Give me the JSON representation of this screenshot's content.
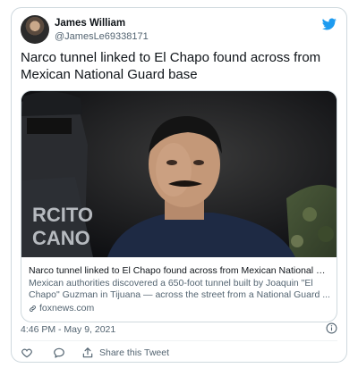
{
  "tweet": {
    "author_name": "James William",
    "author_handle": "@JamesLe69338171",
    "text": "Narco tunnel linked to El Chapo found across from Mexican National Guard base",
    "timestamp": "4:46 PM - May 9, 2021",
    "brand_color": "#1d9bf0"
  },
  "link_card": {
    "image_overlay_text": "RCITO\nCANO",
    "title": "Narco tunnel linked to El Chapo found across from Mexican National Gu...",
    "description": "Mexican authorities discovered a 650-foot tunnel built by Joaquin \"El Chapo\" Guzman in Tijuana — across the street from a National Guard ...",
    "domain": "foxnews.com"
  },
  "actions": {
    "share_label": "Share this Tweet"
  },
  "icons": [
    "twitter-bird-icon",
    "link-icon",
    "info-icon",
    "heart-icon",
    "reply-icon",
    "share-icon"
  ]
}
